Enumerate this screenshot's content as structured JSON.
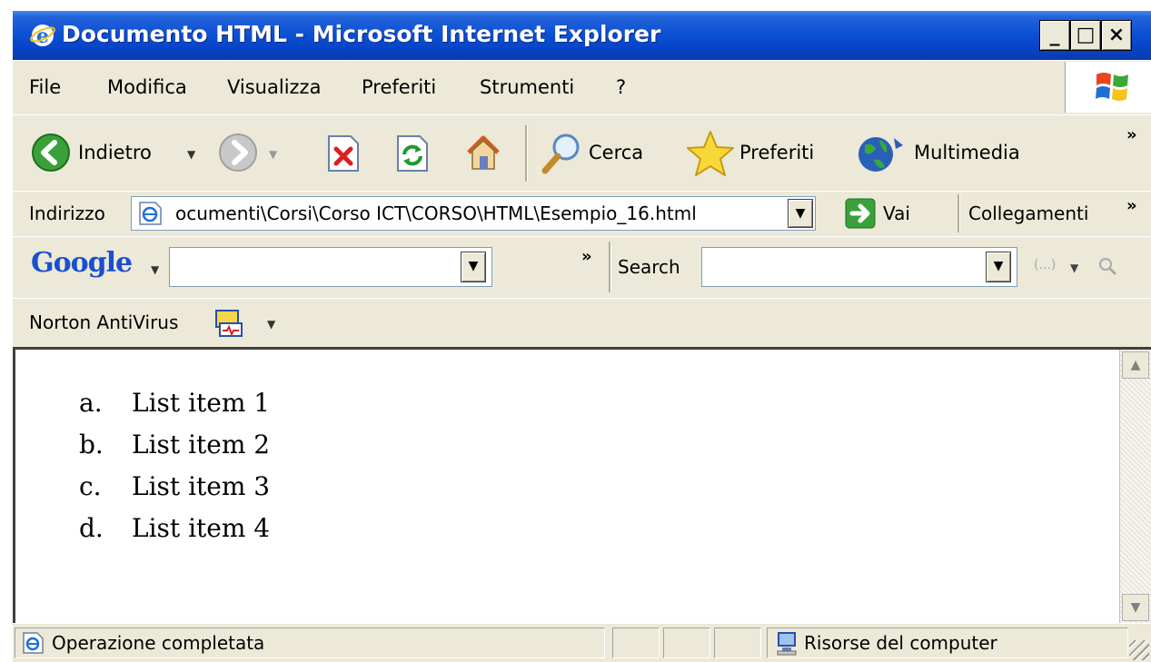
{
  "window": {
    "title": "Documento HTML - Microsoft Internet Explorer",
    "minimize_glyph": "_",
    "maximize_glyph": "□",
    "close_glyph": "×"
  },
  "menubar": {
    "items": [
      "File",
      "Modifica",
      "Visualizza",
      "Preferiti",
      "Strumenti",
      "?"
    ]
  },
  "toolbar": {
    "back_label": "Indietro",
    "search_label": "Cerca",
    "favorites_label": "Preferiti",
    "media_label": "Multimedia",
    "more_glyph": "»",
    "dropdown_glyph": "▼"
  },
  "address": {
    "label": "Indirizzo",
    "value": "ocumenti\\Corsi\\Corso ICT\\CORSO\\HTML\\Esempio_16.html",
    "go_label": "Vai",
    "links_label": "Collegamenti"
  },
  "google_bar": {
    "logo_text": "Google",
    "search_label": "Search",
    "search_value": "",
    "query_value": "",
    "options_glyph": "(...)"
  },
  "norton": {
    "label": "Norton AntiVirus"
  },
  "content": {
    "list": [
      {
        "marker": "a.",
        "text": "List item 1"
      },
      {
        "marker": "b.",
        "text": "List item 2"
      },
      {
        "marker": "c.",
        "text": "List item 3"
      },
      {
        "marker": "d.",
        "text": "List item 4"
      }
    ]
  },
  "statusbar": {
    "status_text": "Operazione completata",
    "zone_text": "Risorse del computer"
  },
  "icons": [
    "ie-icon",
    "windows-logo-icon",
    "back-icon",
    "forward-icon",
    "stop-icon",
    "refresh-icon",
    "home-icon",
    "search-icon",
    "favorites-star-icon",
    "media-icon",
    "page-icon",
    "go-arrow-icon",
    "norton-icon",
    "computer-icon"
  ],
  "colors": {
    "titlebar_blue": "#0a4fd4",
    "chrome_beige": "#ece9d8",
    "back_green": "#3aa13a"
  }
}
